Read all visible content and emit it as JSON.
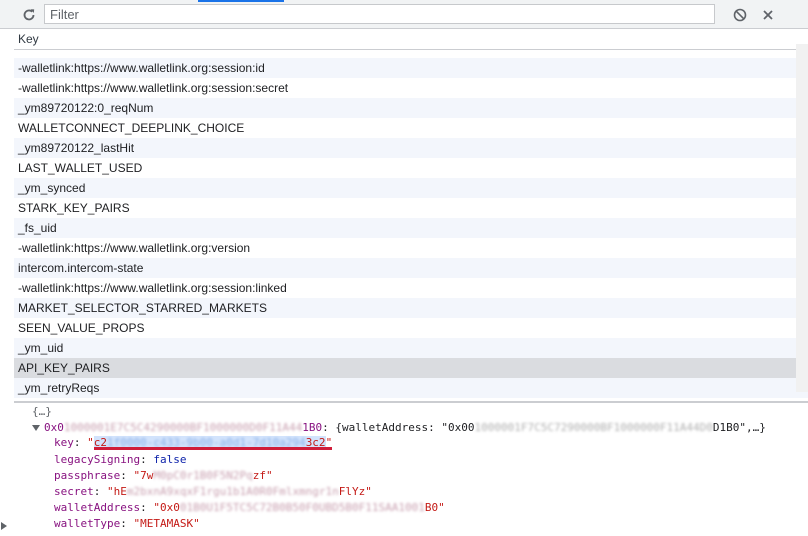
{
  "toolbar": {
    "filter_placeholder": "Filter",
    "refresh_icon": "refresh-icon",
    "clear_icon": "block-icon",
    "close_icon": "close-icon"
  },
  "table": {
    "header": "Key",
    "rows": [
      "-walletlink:https://www.walletlink.org:session:id",
      "-walletlink:https://www.walletlink.org:session:secret",
      "_ym89720122:0_reqNum",
      "WALLETCONNECT_DEEPLINK_CHOICE",
      "_ym89720122_lastHit",
      "LAST_WALLET_USED",
      "_ym_synced",
      "STARK_KEY_PAIRS",
      "_fs_uid",
      "-walletlink:https://www.walletlink.org:version",
      "intercom.intercom-state",
      "-walletlink:https://www.walletlink.org:session:linked",
      "MARKET_SELECTOR_STARRED_MARKETS",
      "SEEN_VALUE_PROPS",
      "_ym_uid",
      "API_KEY_PAIRS",
      "_ym_retryReqs"
    ],
    "selected_index": 15
  },
  "console": {
    "top_partial": "{…}",
    "entry_prefix": "0x0",
    "entry_redacted": "1000001E7C5C4290000BF1000000D0F11A44",
    "entry_suffix": "1B0",
    "entry_summary_prefix": ": {walletAddress: \"0x00",
    "entry_summary_redacted": "1000001F7C5C7290000BF1000000F11A44D0",
    "entry_summary_suffix": "D1B0\",…}",
    "key_label": "key",
    "key_open": "\"",
    "key_start": "c2",
    "key_redacted": "1f0000-c433-9b00-a0d1-7d10a294",
    "key_end": "3c2",
    "key_close": "\"",
    "legacy_label": "legacySigning",
    "legacy_value": "false",
    "pass_label": "passphrase",
    "pass_start": "\"7w",
    "pass_redacted": "M0pC0r1B0F5N2Pq",
    "pass_end": "zf\"",
    "secret_label": "secret",
    "secret_start": "\"hE",
    "secret_redacted": "m2bxnA9xqxF1rgu1b1A0R0Fmlxmngr1n",
    "secret_end": "FlYz\"",
    "wallet_label": "walletAddress",
    "wallet_start": "\"0x0",
    "wallet_redacted": "01B0U1F5TC5C72B0B50F0UBD5B0F11SAA1001",
    "wallet_end": "B0\"",
    "type_label": "walletType",
    "type_value": "\"METAMASK\""
  },
  "colors": {
    "selected_row": "#dadce0",
    "alt_row": "#f3f6fc",
    "underline": "#d01d3a",
    "string": "#c41a16",
    "property": "#881280"
  }
}
